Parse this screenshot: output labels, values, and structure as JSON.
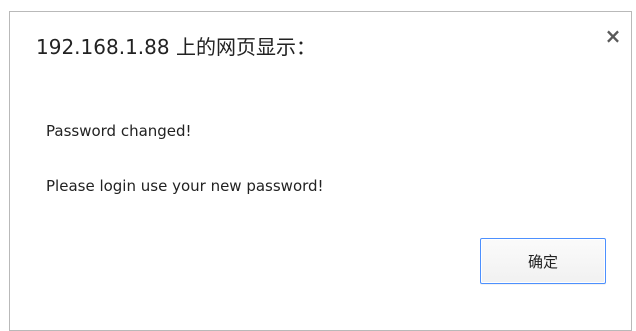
{
  "dialog": {
    "title": "192.168.1.88 上的网页显示：",
    "close_glyph": "×",
    "close_icon": "close-icon",
    "messages": [
      "Password changed!",
      "Please login use your new password!"
    ],
    "ok_label": "确定",
    "accent_color": "#4d90fe"
  }
}
